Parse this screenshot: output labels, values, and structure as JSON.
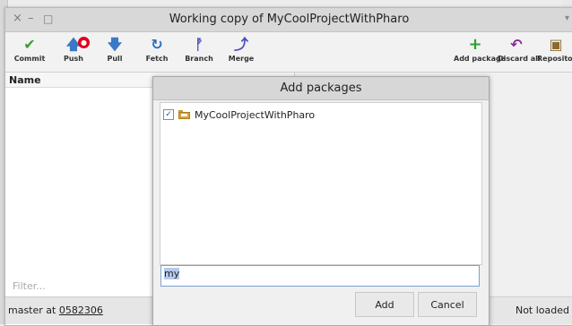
{
  "window": {
    "title": "Working copy of MyCoolProjectWithPharo",
    "controls": [
      "×",
      "–",
      "□"
    ],
    "menu_glyph": "▾"
  },
  "toolbar": {
    "items": [
      {
        "label": "Commit",
        "icon": "check-icon",
        "glyph": "✔",
        "color": "#3a9d3a"
      },
      {
        "label": "Push",
        "icon": "push-arrow-icon",
        "glyph": "🡅",
        "color": "#3a79c6",
        "badge": "●"
      },
      {
        "label": "Pull",
        "icon": "pull-arrow-icon",
        "glyph": "🡇",
        "color": "#3a79c6"
      },
      {
        "label": "Fetch",
        "icon": "fetch-refresh-icon",
        "glyph": "↻",
        "color": "#2c6cc2"
      },
      {
        "label": "Branch",
        "icon": "branch-icon",
        "glyph": "ᚡ",
        "color": "#4a4fc0"
      },
      {
        "label": "Merge",
        "icon": "merge-icon",
        "glyph": "⤴",
        "color": "#4a4fc0"
      },
      {
        "label": "Add package",
        "icon": "plus-icon",
        "glyph": "+",
        "color": "#2aa02a"
      },
      {
        "label": "Discard all",
        "icon": "undo-icon",
        "glyph": "↶",
        "color": "#8b2a9d"
      },
      {
        "label": "Repository",
        "icon": "repository-box-icon",
        "glyph": "▣",
        "color": "#8a6a30"
      }
    ]
  },
  "left_pane": {
    "column_header": "Name",
    "filter_placeholder": "Filter..."
  },
  "status": {
    "branch_text": "master at ",
    "commit": "0582306",
    "right_text": "Not loaded"
  },
  "dialog": {
    "title": "Add packages",
    "packages": [
      {
        "name": "MyCoolProjectWithPharo",
        "checked": true,
        "check_glyph": "✓"
      }
    ],
    "search_value": "my",
    "buttons": {
      "add": "Add",
      "cancel": "Cancel"
    }
  }
}
